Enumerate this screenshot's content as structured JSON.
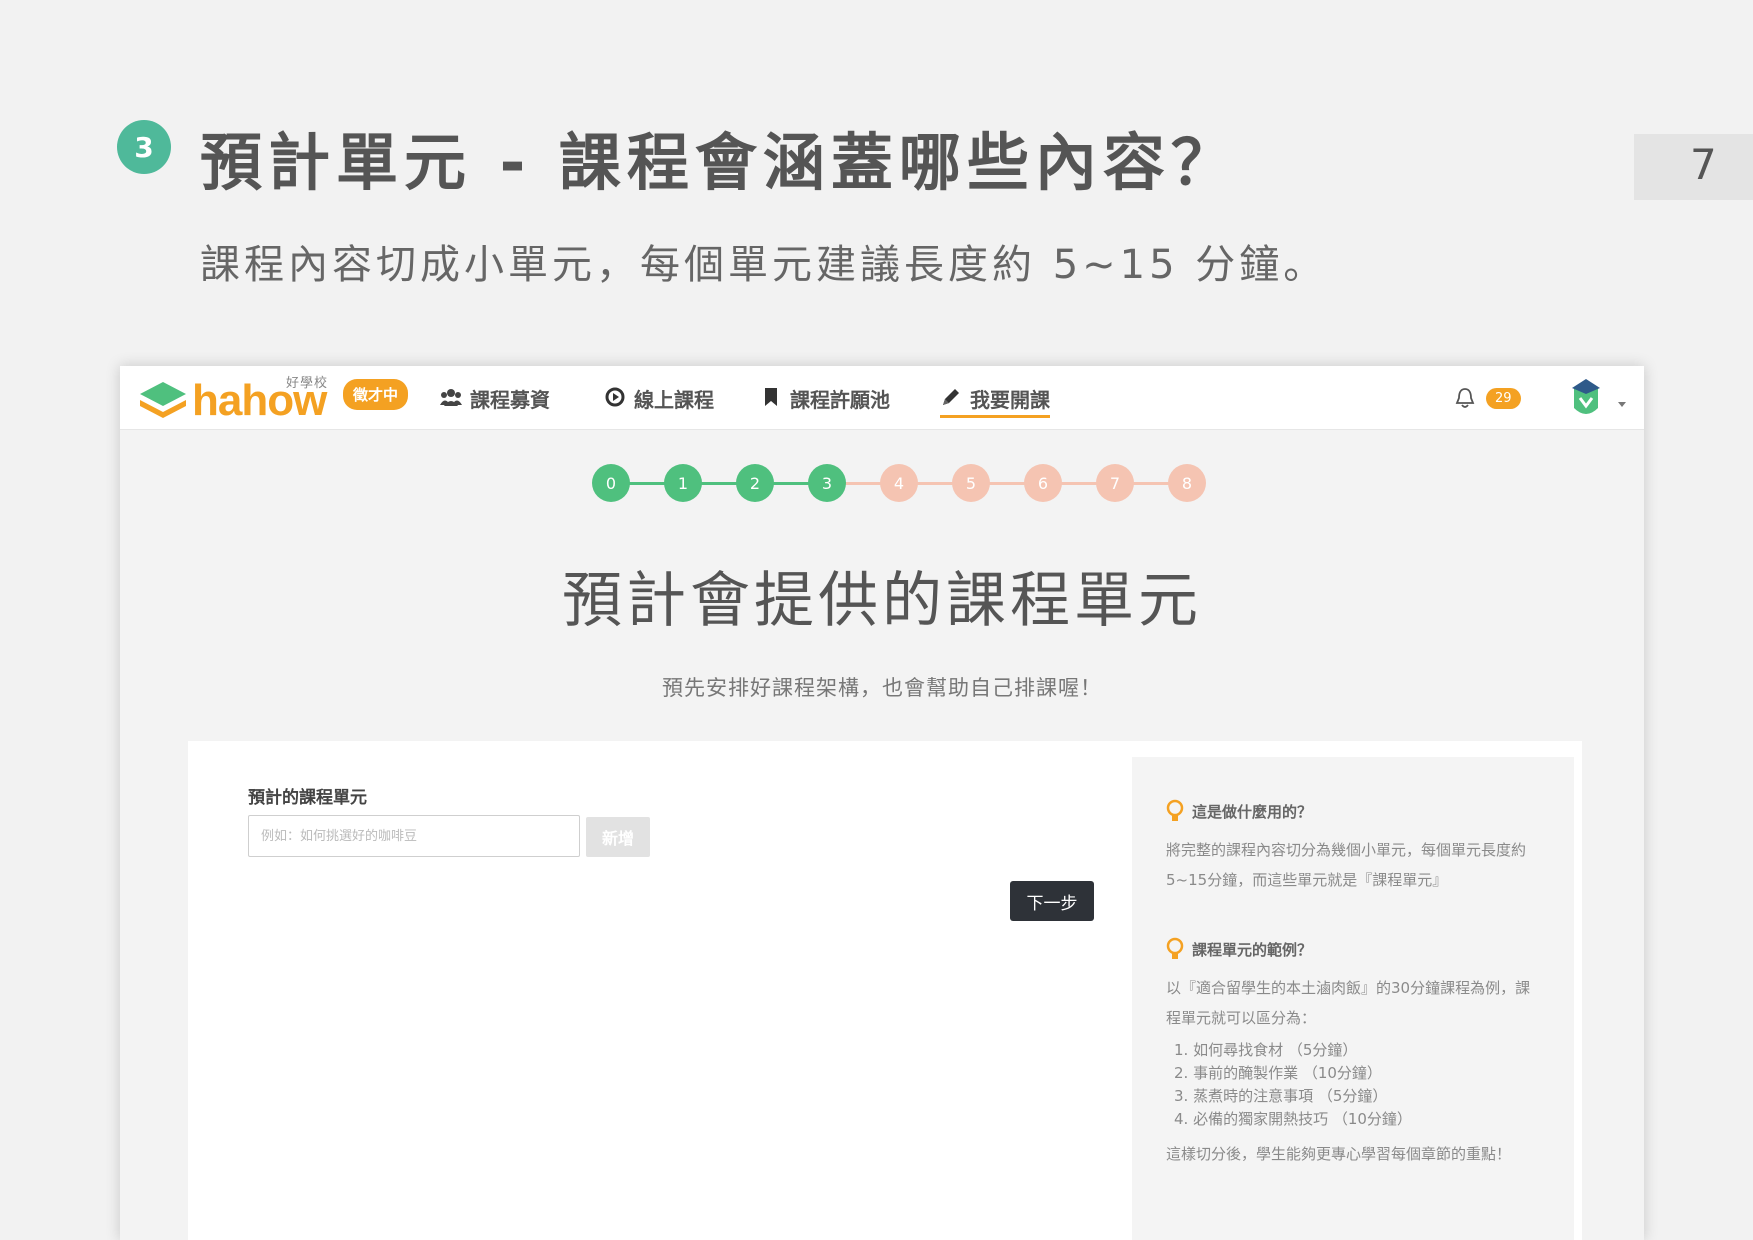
{
  "slide": {
    "step_number": "3",
    "title": "預計單元 - 課程會涵蓋哪些內容？",
    "subtitle": "課程內容切成小單元，每個單元建議長度約 5~15 分鐘。",
    "page_number": "7"
  },
  "navbar": {
    "logo_small": "好學校",
    "logo_text": "hahow",
    "logo_badge": "徵才中",
    "items": [
      {
        "label": "課程募資",
        "icon": "users-icon"
      },
      {
        "label": "線上課程",
        "icon": "play-circle-icon"
      },
      {
        "label": "課程許願池",
        "icon": "bookmark-icon"
      },
      {
        "label": "我要開課",
        "icon": "pencil-icon",
        "active": true
      }
    ],
    "notification_count": "29"
  },
  "progress": {
    "steps": [
      "0",
      "1",
      "2",
      "3",
      "4",
      "5",
      "6",
      "7",
      "8"
    ],
    "current_step": 3,
    "colors": {
      "done": "#4fc07e",
      "todo": "#f5c4b2"
    }
  },
  "main": {
    "title": "預計會提供的課程單元",
    "subtitle": "預先安排好課程架構，也會幫助自己排課喔！"
  },
  "form": {
    "label": "預計的課程單元",
    "input_placeholder": "例如：如何挑選好的咖啡豆",
    "input_value": "",
    "add_label": "新增",
    "next_label": "下一步"
  },
  "help": {
    "q1": "這是做什麼用的？",
    "a1": "將完整的課程內容切分為幾個小單元，每個單元長度約5~15分鐘，而這些單元就是『課程單元』",
    "q2": "課程單元的範例？",
    "a2": "以『適合留學生的本土滷肉飯』的30分鐘課程為例，課程單元就可以區分為：",
    "list": [
      "1. 如何尋找食材 （5分鐘）",
      "2. 事前的醃製作業 （10分鐘）",
      "3. 蒸煮時的注意事項 （5分鐘）",
      "4. 必備的獨家開熱技巧 （10分鐘）"
    ],
    "a3": "這樣切分後，學生能夠更專心學習每個章節的重點！"
  },
  "colors": {
    "accent_orange": "#f4a122",
    "step_teal": "#4fb99a",
    "dark_button": "#2e3238"
  }
}
